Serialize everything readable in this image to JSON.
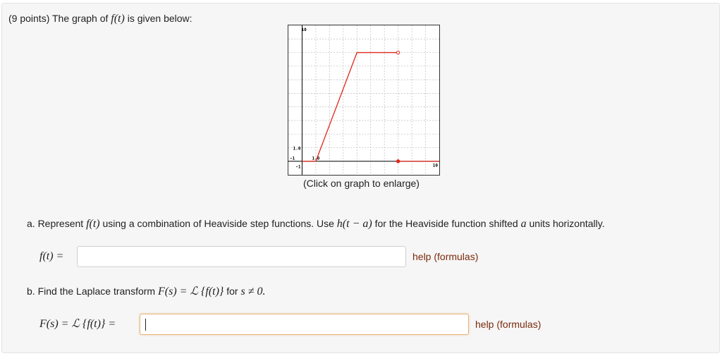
{
  "problem": {
    "intro_prefix": "(9 points) The graph of",
    "intro_func": "f(t)",
    "intro_suffix": "is given below:",
    "caption": "(Click on graph to enlarge)",
    "part_a": {
      "prefix": "a. Represent",
      "func": "f(t)",
      "middle": "using a combination of Heaviside step functions. Use",
      "heaviside": "h(t − a)",
      "after": "for the Heaviside function shifted",
      "a_var": "a",
      "end": "units horizontally.",
      "answer_label": "f(t) =",
      "answer_value": "",
      "help_link": "help (formulas)"
    },
    "part_b": {
      "prefix": "b. Find the Laplace transform",
      "expr": "F(s) = ℒ {f(t)}",
      "for_text": "for",
      "cond": "s ≠ 0.",
      "answer_label": "F(s) = ℒ {f(t)} =",
      "answer_value": "",
      "help_link": "help (formulas)"
    }
  },
  "chart_data": {
    "type": "line",
    "title": "",
    "xlim": [
      -1,
      10
    ],
    "ylim": [
      -1,
      10
    ],
    "tick_labels": {
      "x_min": "-1",
      "x_max": "10",
      "y_min": "-1",
      "y_max": "10",
      "x_one": "1.0",
      "y_one": "1.0"
    },
    "grid": true,
    "grid_step": 1,
    "series": [
      {
        "points": [
          [
            0,
            0
          ],
          [
            1,
            0
          ]
        ],
        "color": "#e0271a"
      },
      {
        "points": [
          [
            1,
            0
          ],
          [
            4,
            8
          ],
          [
            7,
            8
          ]
        ],
        "color": "#e0271a"
      },
      {
        "points": [
          [
            7,
            0
          ],
          [
            10,
            0
          ]
        ],
        "color": "#e0271a"
      }
    ],
    "markers": [
      {
        "x": 7,
        "y": 8,
        "style": "open"
      },
      {
        "x": 7,
        "y": 0,
        "style": "closed"
      }
    ],
    "colors": {
      "line": "#e0271a",
      "axis": "#000000",
      "grid": "#bdbdbd"
    }
  }
}
